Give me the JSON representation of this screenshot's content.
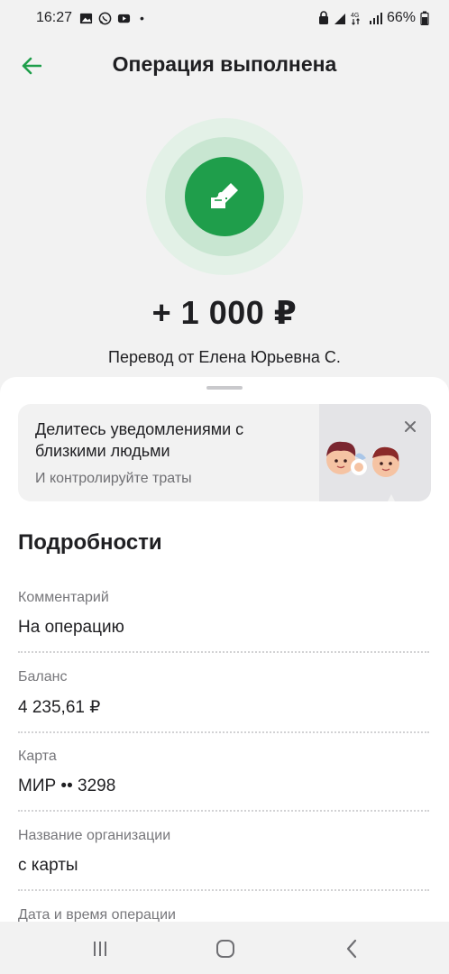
{
  "status_bar": {
    "time": "16:27",
    "battery": "66%",
    "notification_icons": [
      "image-icon",
      "whatsapp-icon",
      "youtube-icon"
    ],
    "dot": "•"
  },
  "header": {
    "title": "Операция выполнена"
  },
  "hero": {
    "amount": "+ 1 000 ₽",
    "sender": "Перевод от Елена Юрьевна С."
  },
  "promo": {
    "title": "Делитесь уведомлениями с близкими людьми",
    "subtitle": "И контролируйте траты"
  },
  "details": {
    "title": "Подробности",
    "items": [
      {
        "label": "Комментарий",
        "value": "На операцию"
      },
      {
        "label": "Баланс",
        "value": "4 235,61 ₽"
      },
      {
        "label": "Карта",
        "value": "МИР •• 3298"
      },
      {
        "label": "Название организации",
        "value": "с карты"
      },
      {
        "label": "Дата и время операции",
        "value": ""
      }
    ]
  },
  "colors": {
    "accent": "#1f9e4b",
    "background": "#f2f2f2",
    "text": "#1f1f22",
    "muted": "#77777b"
  }
}
